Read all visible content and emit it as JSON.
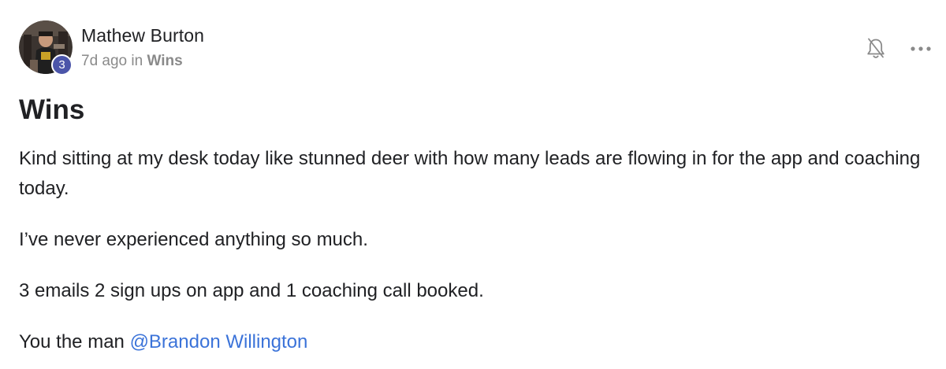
{
  "post": {
    "author": {
      "name": "Mathew Burton",
      "level": "3"
    },
    "meta": {
      "time_ago": "7d ago in",
      "category": "Wins"
    },
    "title": "Wins",
    "paragraphs": [
      "Kind sitting at my desk today like stunned deer with how many leads are flowing in for the app and coaching today.",
      "I’ve never experienced anything so much.",
      "3 emails 2 sign ups on app and 1 coaching call booked."
    ],
    "closing": {
      "text": "You the man ",
      "mention": "@Brandon Willington"
    }
  },
  "icons": {
    "notification": "bell-off-icon",
    "more": "more-horizontal-icon"
  },
  "colors": {
    "badge": "#4b55a9",
    "mention": "#3b73d9",
    "muted": "#8a8a8a",
    "text": "#202124"
  }
}
